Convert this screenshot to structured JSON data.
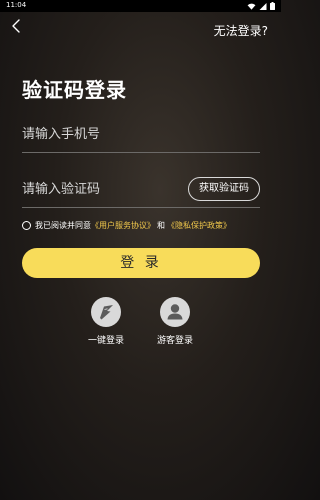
{
  "status_bar": {
    "time": "11:04"
  },
  "header": {
    "help_label": "无法登录?"
  },
  "page": {
    "title": "验证码登录"
  },
  "form": {
    "phone_placeholder": "请输入手机号",
    "phone_value": "",
    "code_placeholder": "请输入验证码",
    "code_value": "",
    "get_code_label": "获取验证码"
  },
  "agreement": {
    "prefix": "我已阅读并同意",
    "user_agreement": "《用户服务协议》",
    "conjunction": "和",
    "privacy_policy": "《隐私保护政策》",
    "checked": false,
    "link_color": "#f2c94c"
  },
  "login": {
    "label": "登 录",
    "button_color": "#f8dc5a"
  },
  "quick_login": [
    {
      "label": "一键登录",
      "icon": "lightning-icon"
    },
    {
      "label": "游客登录",
      "icon": "user-icon"
    }
  ]
}
